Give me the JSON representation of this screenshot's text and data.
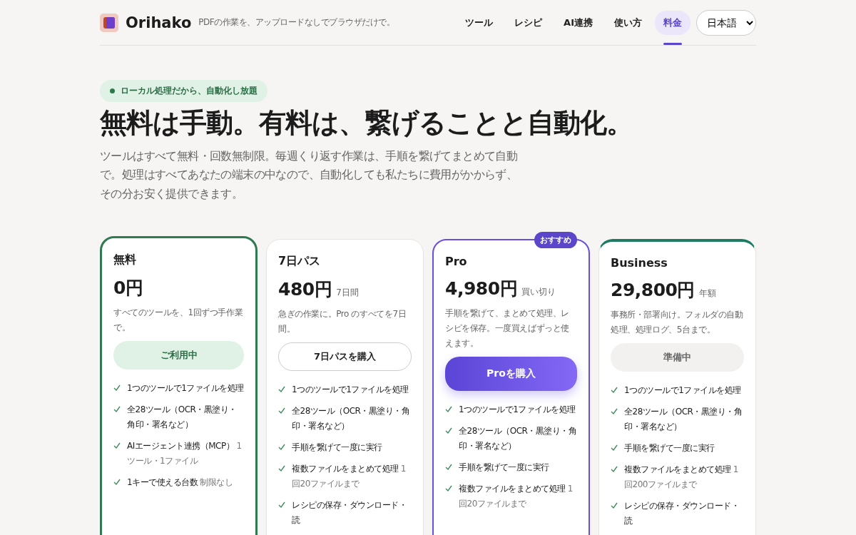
{
  "header": {
    "brand": "Orihako",
    "tagline": "PDFの作業を、アップロードなしでブラウザだけで。",
    "nav": [
      {
        "label": "ツール",
        "selected": false
      },
      {
        "label": "レシピ",
        "selected": false
      },
      {
        "label": "AI連携",
        "selected": false
      },
      {
        "label": "使い方",
        "selected": false
      },
      {
        "label": "料金",
        "selected": true
      }
    ],
    "language": "日本語"
  },
  "hero": {
    "badge": "ローカル処理だから、自動化し放題",
    "title": "無料は手動。有料は、繋げることと自動化。",
    "lead": "ツールはすべて無料・回数無制限。毎週くり返す作業は、手順を繋げてまとめて自動で。処理はすべてあなたの端末の中なので、自動化しても私たちに費用がかからず、その分お安く提供できます。"
  },
  "plans": [
    {
      "kind": "current",
      "name": "無料",
      "price": "0円",
      "description": "すべてのツールを、1回ずつ手作業で。",
      "button": {
        "kind": "current",
        "label": "ご利用中"
      },
      "features": [
        {
          "text": "1つのツールで1ファイルを処理"
        },
        {
          "text": "全28ツール（OCR・黒塗り・角印・署名など）"
        },
        {
          "text": "AIエージェント連携（MCP）",
          "note": "1ツール・1ファイル"
        },
        {
          "text": "1キーで使える台数",
          "note": "制限なし"
        }
      ]
    },
    {
      "kind": "plain",
      "name": "7日パス",
      "price": "480円",
      "period": "7日間",
      "description": "急ぎの作業に。Pro のすべてを7日間。",
      "button": {
        "kind": "outline",
        "label": "7日パスを購入"
      },
      "features": [
        {
          "text": "1つのツールで1ファイルを処理"
        },
        {
          "text": "全28ツール（OCR・黒塗り・角印・署名など）"
        },
        {
          "text": "手順を繋げて一度に実行"
        },
        {
          "text": "複数ファイルをまとめて処理",
          "note": "1回20ファイルまで"
        },
        {
          "text": "レシピの保存・ダウンロード・読"
        }
      ]
    },
    {
      "kind": "featured",
      "badge": "おすすめ",
      "name": "Pro",
      "price": "4,980円",
      "period": "買い切り",
      "description": "手順を繋げて、まとめて処理、レシピを保存。一度買えばずっと使えます。",
      "button": {
        "kind": "primary",
        "label": "Proを購入"
      },
      "features": [
        {
          "text": "1つのツールで1ファイルを処理"
        },
        {
          "text": "全28ツール（OCR・黒塗り・角印・署名など）"
        },
        {
          "text": "手順を繋げて一度に実行"
        },
        {
          "text": "複数ファイルをまとめて処理",
          "note": "1回20ファイルまで"
        }
      ]
    },
    {
      "kind": "upcoming",
      "name": "Business",
      "price": "29,800円",
      "period": "年額",
      "description": "事務所・部署向け。フォルダの自動処理、処理ログ、5台まで。",
      "button": {
        "kind": "disabled",
        "label": "準備中"
      },
      "features": [
        {
          "text": "1つのツールで1ファイルを処理"
        },
        {
          "text": "全28ツール（OCR・黒塗り・角印・署名など）"
        },
        {
          "text": "手順を繋げて一度に実行"
        },
        {
          "text": "複数ファイルをまとめて処理",
          "note": "1回200ファイルまで"
        },
        {
          "text": "レシピの保存・ダウンロード・読"
        }
      ]
    }
  ]
}
